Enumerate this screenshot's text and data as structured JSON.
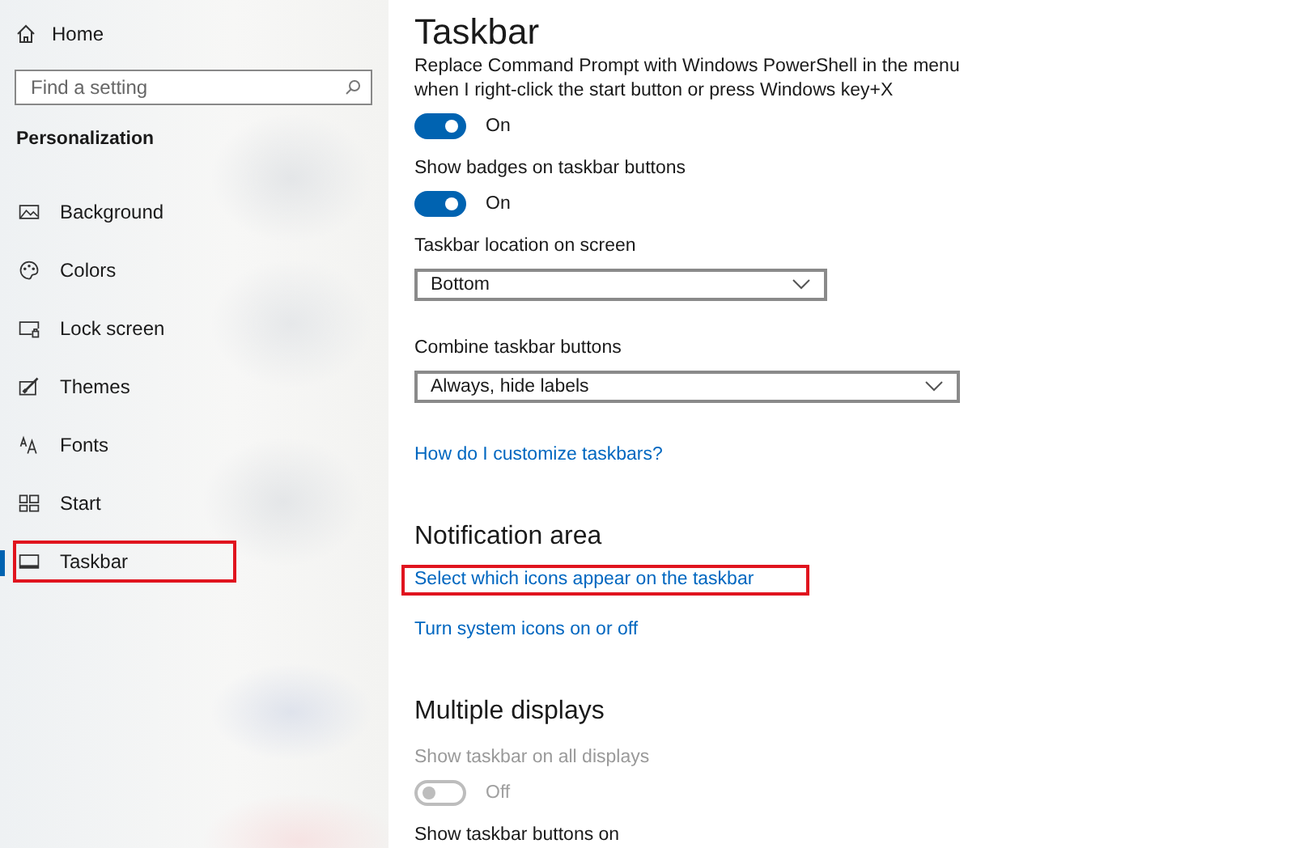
{
  "sidebar": {
    "home": "Home",
    "search": {
      "placeholder": "Find a setting"
    },
    "section": "Personalization",
    "items": [
      {
        "label": "Background",
        "selected": false,
        "highlighted": false
      },
      {
        "label": "Colors",
        "selected": false,
        "highlighted": false
      },
      {
        "label": "Lock screen",
        "selected": false,
        "highlighted": false
      },
      {
        "label": "Themes",
        "selected": false,
        "highlighted": false
      },
      {
        "label": "Fonts",
        "selected": false,
        "highlighted": false
      },
      {
        "label": "Start",
        "selected": false,
        "highlighted": false
      },
      {
        "label": "Taskbar",
        "selected": true,
        "highlighted": true
      }
    ]
  },
  "page": {
    "title": "Taskbar",
    "settings": [
      {
        "kind": "toggle",
        "label": "Replace Command Prompt with Windows PowerShell in the menu when I right-click the start button or press Windows key+X",
        "on": true,
        "state": "On",
        "disabled": false
      },
      {
        "kind": "toggle",
        "label": "Show badges on taskbar buttons",
        "on": true,
        "state": "On",
        "disabled": false
      },
      {
        "kind": "dropdown",
        "label": "Taskbar location on screen",
        "value": "Bottom"
      },
      {
        "kind": "dropdown",
        "label": "Combine taskbar buttons",
        "value": "Always, hide labels"
      },
      {
        "kind": "link",
        "label": "How do I customize taskbars?",
        "highlighted": false
      },
      {
        "kind": "heading",
        "label": "Notification area"
      },
      {
        "kind": "link",
        "label": "Select which icons appear on the taskbar",
        "highlighted": true
      },
      {
        "kind": "link",
        "label": "Turn system icons on or off",
        "highlighted": false
      },
      {
        "kind": "heading",
        "label": "Multiple displays"
      },
      {
        "kind": "toggle",
        "label": "Show taskbar on all displays",
        "on": false,
        "state": "Off",
        "disabled": true
      },
      {
        "kind": "label",
        "label": "Show taskbar buttons on"
      }
    ]
  }
}
